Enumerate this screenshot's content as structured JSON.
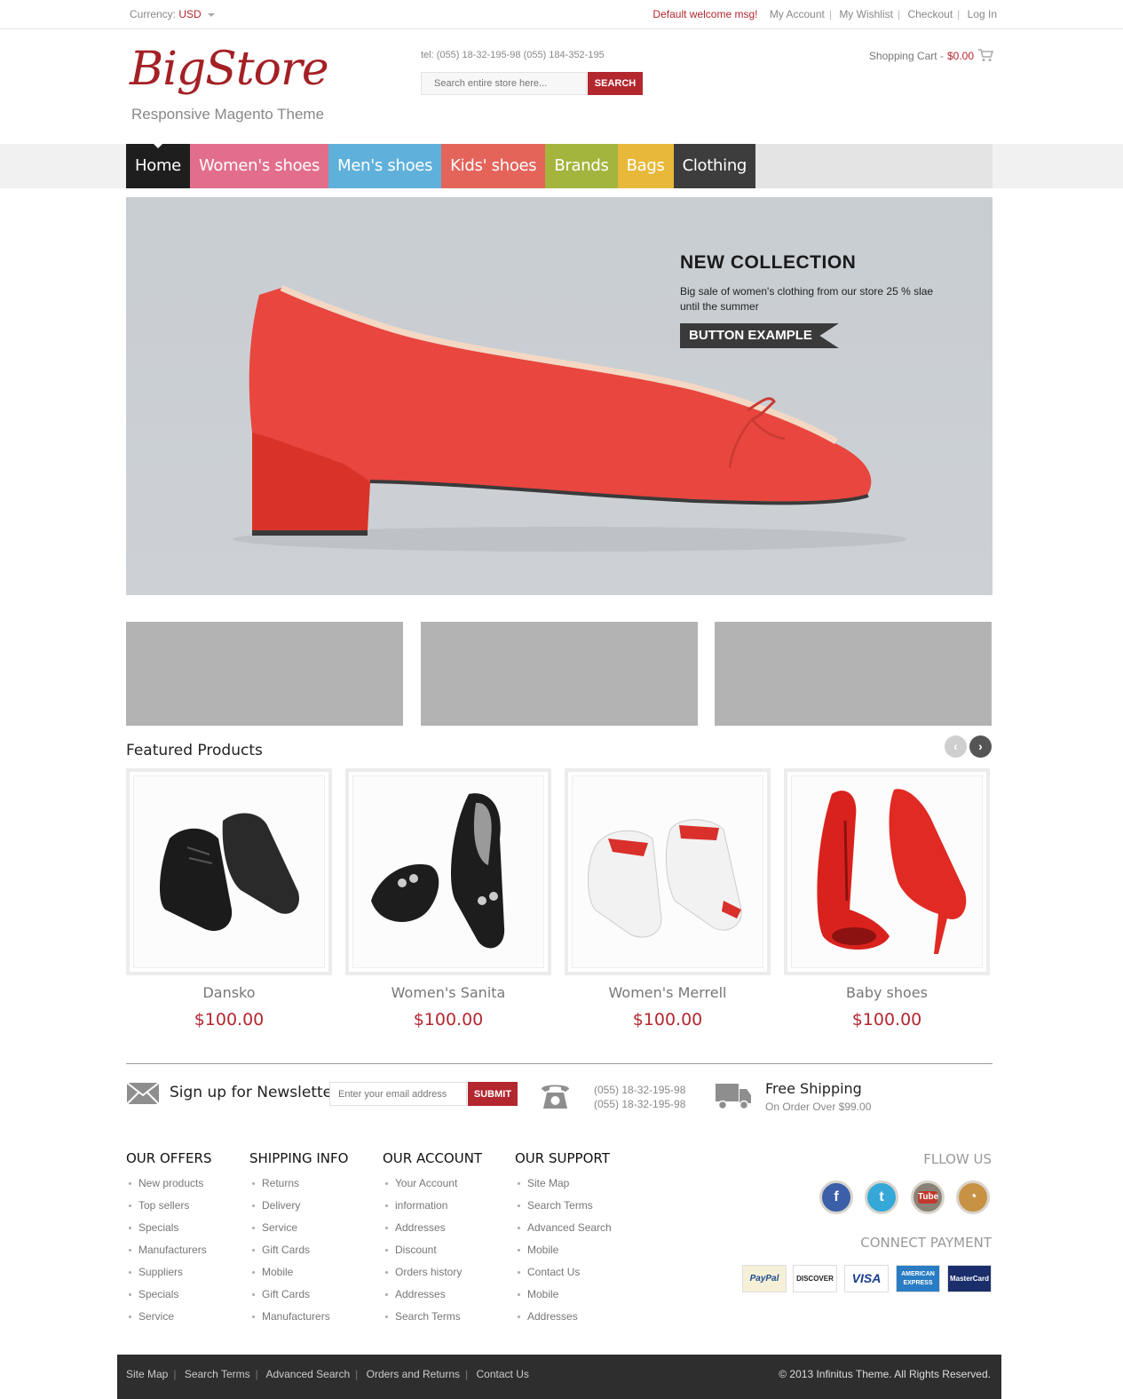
{
  "topbar": {
    "currency_label": "Currency:",
    "currency_value": "USD",
    "welcome": "Default welcome msg!",
    "links": [
      "My Account",
      "My Wishlist",
      "Checkout",
      "Log In"
    ]
  },
  "header": {
    "logo_text": "BigStore",
    "logo_sub": "Responsive Magento Theme",
    "tel": "tel: (055) 18-32-195-98 (055) 184-352-195",
    "search_placeholder": "Search entire store here...",
    "search_button": "SEARCH",
    "cart_label": "Shopping Cart - ",
    "cart_amount": "$0.00"
  },
  "nav": {
    "items": [
      {
        "label": "Home",
        "color": "#1e1e1e"
      },
      {
        "label": "Women's shoes",
        "color": "#e26e8b"
      },
      {
        "label": "Men's shoes",
        "color": "#5fb1db"
      },
      {
        "label": "Kids' shoes",
        "color": "#e4645a"
      },
      {
        "label": "Brands",
        "color": "#a4b53e"
      },
      {
        "label": "Bags",
        "color": "#e8b83a"
      },
      {
        "label": "Clothing",
        "color": "#3d3d3d"
      }
    ]
  },
  "slider": {
    "title": "NEW COLLECTION",
    "text": "Big sale of women's clothing from our store 25 % slae until the summer",
    "button": "BUTTON EXAMPLE"
  },
  "featured": {
    "title": "Featured Products",
    "products": [
      {
        "name": "Dansko",
        "price": "$100.00"
      },
      {
        "name": "Women's Sanita",
        "price": "$100.00"
      },
      {
        "name": "Women's Merrell",
        "price": "$100.00"
      },
      {
        "name": "Baby shoes",
        "price": "$100.00"
      }
    ]
  },
  "newsletter": {
    "label": "Sign up for Newsletter",
    "placeholder": "Enter your email address",
    "button": "SUBMIT",
    "phone1": "(055) 18-32-195-98",
    "phone2": "(055) 18-32-195-98",
    "ship_title": "Free Shipping",
    "ship_sub": "On Order Over $99.00"
  },
  "footer": {
    "columns": [
      {
        "title": "OUR OFFERS",
        "items": [
          "New products",
          "Top sellers",
          "Specials",
          "Manufacturers",
          "Suppliers",
          "Specials",
          "Service"
        ]
      },
      {
        "title": "SHIPPING INFO",
        "items": [
          "Returns",
          "Delivery",
          "Service",
          "Gift Cards",
          "Mobile",
          "Gift Cards",
          "Manufacturers"
        ]
      },
      {
        "title": "OUR ACCOUNT",
        "items": [
          "Your Account",
          "information",
          "Addresses",
          "Discount",
          "Orders history",
          "Addresses",
          "Search Terms"
        ]
      },
      {
        "title": "OUR SUPPORT",
        "items": [
          "Site Map",
          "Search Terms",
          "Advanced Search",
          "Mobile",
          "Contact Us",
          "Mobile",
          "Addresses"
        ]
      }
    ],
    "follow_title": "FLLOW US",
    "payment_title": "CONNECT PAYMENT",
    "cards": [
      "PayPal",
      "DISCOVER",
      "VISA",
      "AMERICAN EXPRESS",
      "MasterCard"
    ],
    "bottom_links": [
      "Site Map",
      "Search Terms",
      "Advanced Search",
      "Orders and Returns",
      "Contact Us"
    ],
    "copyright": "© 2013 Infinitus Theme. All Rights Reserved."
  },
  "colors": {
    "accent": "#b3272f",
    "nav_bg": "#e4e4e4",
    "footer_bg": "#2e2e2e"
  }
}
